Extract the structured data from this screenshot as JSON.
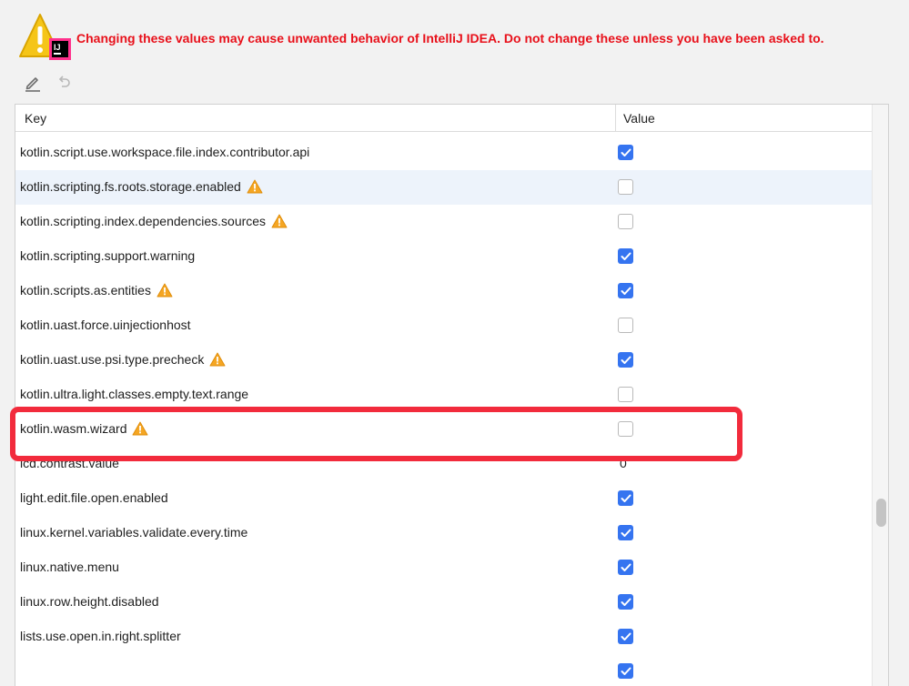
{
  "banner": {
    "logo_text": "IJ",
    "warning_text": "Changing these values may cause unwanted behavior of IntelliJ IDEA. Do not change these unless you have been asked to."
  },
  "toolbar": {
    "edit_icon": "pencil-icon",
    "undo_icon": "undo-icon"
  },
  "table": {
    "header_key": "Key",
    "header_value": "Value",
    "rows": [
      {
        "key": "kotlin.script.use.workspace.file.index.contributor.api",
        "warn": false,
        "type": "bool",
        "checked": true
      },
      {
        "key": "kotlin.scripting.fs.roots.storage.enabled",
        "warn": true,
        "type": "bool",
        "checked": false,
        "selected": true
      },
      {
        "key": "kotlin.scripting.index.dependencies.sources",
        "warn": true,
        "type": "bool",
        "checked": false
      },
      {
        "key": "kotlin.scripting.support.warning",
        "warn": false,
        "type": "bool",
        "checked": true
      },
      {
        "key": "kotlin.scripts.as.entities",
        "warn": true,
        "type": "bool",
        "checked": true
      },
      {
        "key": "kotlin.uast.force.uinjectionhost",
        "warn": false,
        "type": "bool",
        "checked": false
      },
      {
        "key": "kotlin.uast.use.psi.type.precheck",
        "warn": true,
        "type": "bool",
        "checked": true
      },
      {
        "key": "kotlin.ultra.light.classes.empty.text.range",
        "warn": false,
        "type": "bool",
        "checked": false
      },
      {
        "key": "kotlin.wasm.wizard",
        "warn": true,
        "type": "bool",
        "checked": false
      },
      {
        "key": "lcd.contrast.value",
        "warn": false,
        "type": "text",
        "value": "0"
      },
      {
        "key": "light.edit.file.open.enabled",
        "warn": false,
        "type": "bool",
        "checked": true
      },
      {
        "key": "linux.kernel.variables.validate.every.time",
        "warn": false,
        "type": "bool",
        "checked": true
      },
      {
        "key": "linux.native.menu",
        "warn": false,
        "type": "bool",
        "checked": true
      },
      {
        "key": "linux.row.height.disabled",
        "warn": false,
        "type": "bool",
        "checked": true
      },
      {
        "key": "lists.use.open.in.right.splitter",
        "warn": false,
        "type": "bool",
        "checked": true
      },
      {
        "key": "",
        "warn": false,
        "type": "bool",
        "checked": true
      }
    ]
  },
  "colors": {
    "warning_text": "#e8101a",
    "checkbox_on": "#3574f0",
    "highlight": "#f22b3c",
    "selected_row": "#edf3fb"
  }
}
